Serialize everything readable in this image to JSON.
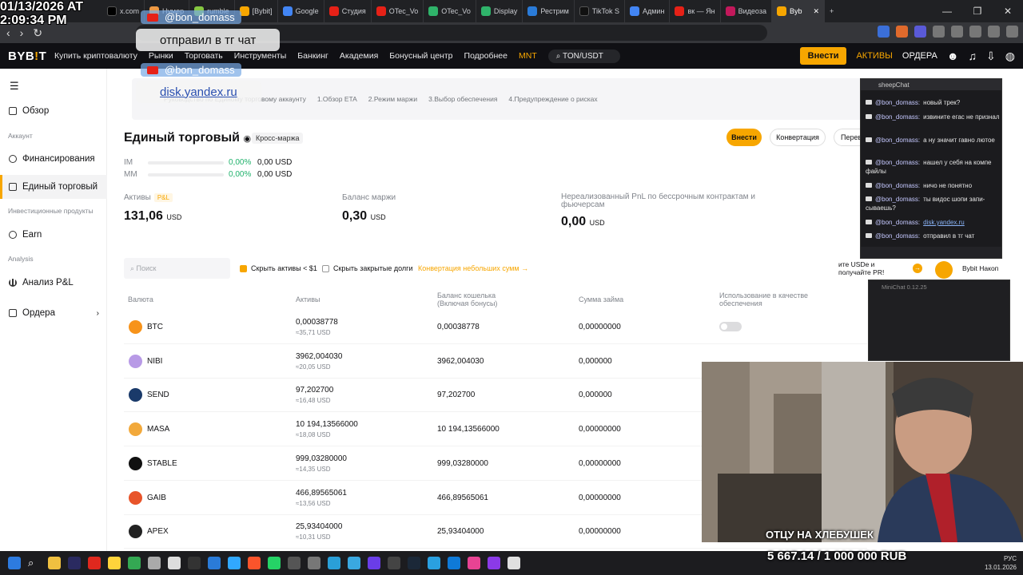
{
  "overlay": {
    "timestamp_line1": "01/13/2026 AT",
    "timestamp_line2": "2:09:34 PM",
    "bubble1_user": "@bon_domass",
    "bubble1_text": "отправил в тг чат",
    "bubble2_user": "@bon_domass",
    "bubble2_text": "disk.yandex.ru",
    "donation": "5 667.14 / 1 000 000 RUB",
    "webcam_caption": "ОТЦУ НА ХЛЕБУШЕК"
  },
  "browser": {
    "tabs": [
      "x.com",
      "Нумер",
      "rumble",
      "[Bybit]",
      "Google",
      "Студия",
      "OTec_Vo",
      "OTec_Vo",
      "Display",
      "Рестрим",
      "TikTok S",
      "Админ",
      "вк — Ян",
      "Видеоза",
      "Byb"
    ],
    "new_tab": "+"
  },
  "header": {
    "logo": "BYB",
    "logo_accent": "!",
    "logo_tail": "T",
    "nav": [
      "Купить криптовалюту",
      "Рынки",
      "Торговать",
      "Инструменты",
      "Банкинг",
      "Академия",
      "Бонусный центр",
      "Подробнее",
      "MNT"
    ],
    "pair": "TON/USDT",
    "deposit": "Внести",
    "assets": "АКТИВЫ",
    "orders": "ОРДЕРА"
  },
  "sidebar": {
    "overview": "Обзор",
    "section_account": "Аккаунт",
    "funding": "Финансирования",
    "unified": "Единый торговый",
    "section_invest": "Инвестиционные продукты",
    "earn": "Earn",
    "section_analysis": "Analysis",
    "pnl": "Анализ P&L",
    "orders": "Ордера"
  },
  "main": {
    "guide_steps": [
      "Руководство по Единому торговому аккаунту",
      "1.Обзор ETA",
      "2.Режим маржи",
      "3.Выбор обеспечения",
      "4.Предупреждение о рисках"
    ],
    "title": "Единый торговый",
    "cross_margin": "Кросс-маржа",
    "btn_deposit": "Внести",
    "btn_convert": "Конвертация",
    "btn_transfer": "Перев",
    "im_label": "IM",
    "im_pct": "0,00%",
    "im_usd": "0,00 USD",
    "mm_label": "MM",
    "mm_pct": "0,00%",
    "mm_usd": "0,00 USD",
    "assets_label": "Активы",
    "pnl_chip": "P&L",
    "assets_value": "131,06",
    "assets_unit": "USD",
    "margin_label": "Баланс маржи",
    "margin_value": "0,30",
    "margin_unit": "USD",
    "unrealized_label": "Нереализованный PnL по бессрочным контрактам и фьючерсам",
    "unrealized_value": "0,00",
    "unrealized_unit": "USD",
    "search_placeholder": "Поиск",
    "hide_small": "Скрыть активы < $1",
    "hide_closed": "Скрыть закрытые долги",
    "convert_small": "Конвертация небольших сумм",
    "columns": [
      "Валюта",
      "Активы",
      "Баланс кошелька",
      "(Включая бонусы)",
      "Сумма займа",
      "Использование в качестве обеспечения"
    ],
    "rows": [
      {
        "coin": "BTC",
        "asset": "0,00038778",
        "asset_usd": "≈35,71 USD",
        "wallet": "0,00038778",
        "loan": "0,00000000",
        "color": "#f7931a"
      },
      {
        "coin": "NIBI",
        "asset": "3962,004030",
        "asset_usd": "≈20,05 USD",
        "wallet": "3962,004030",
        "loan": "0,000000",
        "color": "#b89ae6"
      },
      {
        "coin": "SEND",
        "asset": "97,202700",
        "asset_usd": "≈16,48 USD",
        "wallet": "97,202700",
        "loan": "0,000000",
        "color": "#1a3a6a"
      },
      {
        "coin": "MASA",
        "asset": "10 194,13566000",
        "asset_usd": "≈18,08 USD",
        "wallet": "10 194,13566000",
        "loan": "0,00000000",
        "color": "#f2a93b"
      },
      {
        "coin": "STABLE",
        "asset": "999,03280000",
        "asset_usd": "≈14,35 USD",
        "wallet": "999,03280000",
        "loan": "0,00000000",
        "color": "#111111"
      },
      {
        "coin": "GAIB",
        "asset": "466,89565061",
        "asset_usd": "≈13,56 USD",
        "wallet": "466,89565061",
        "loan": "0,00000000",
        "color": "#e8542a"
      },
      {
        "coin": "APEX",
        "asset": "25,93404000",
        "asset_usd": "≈10,31 USD",
        "wallet": "25,93404000",
        "loan": "0,00000000",
        "color": "#222222"
      }
    ]
  },
  "chat": {
    "title": "sheepChat",
    "messages": [
      {
        "user": "@bon_domass:",
        "text": "новый трек?"
      },
      {
        "user": "@bon_domass:",
        "text": "извините егас не признал"
      },
      {
        "user": "@bon_domass:",
        "text": "а ну значит гавно лютое"
      },
      {
        "user": "@bon_domass:",
        "text": "нашел у себя на компе файлы"
      },
      {
        "user": "@bon_domass:",
        "text": "ничо не понятно"
      },
      {
        "user": "@bon_domass:",
        "text": "ты видос шопи запи-сываешь?"
      },
      {
        "user": "@bon_domass:",
        "text": "disk.yandex.ru"
      },
      {
        "user": "@bon_domass:",
        "text": "отправил в тг чат"
      }
    ]
  },
  "promo": {
    "text": "ите USDe и получайте PR!",
    "right": "Bybit Накоп"
  },
  "minichat": {
    "title": "MiniChat 0.12.25"
  },
  "tray": {
    "lang": "РУС",
    "date": "13.01.2026"
  }
}
